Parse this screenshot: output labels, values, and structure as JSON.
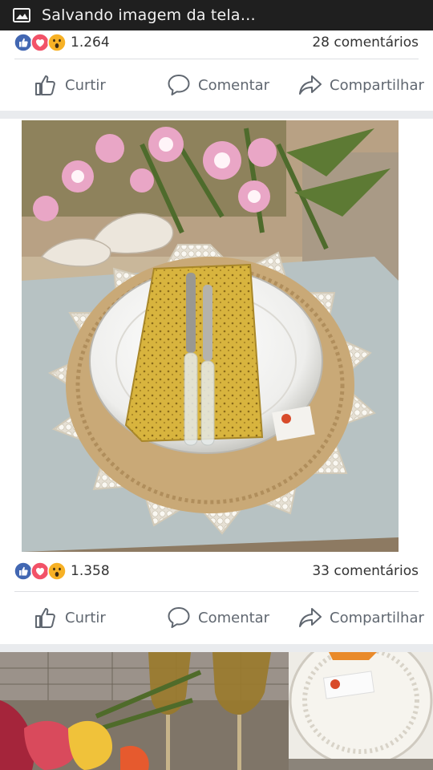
{
  "status_bar": {
    "text": "Salvando imagem da tela…",
    "icon": "image-icon"
  },
  "actions": {
    "like": "Curtir",
    "comment": "Comentar",
    "share": "Compartilhar"
  },
  "posts": [
    {
      "reactions_count": "1.264",
      "comments_count": "28 comentários"
    },
    {
      "reactions_count": "1.358",
      "comments_count": "33 comentários",
      "image_alt": "Sousplat de pérolas com prato branco, guardanapo amarelo e talheres sobre mesa com flores"
    },
    {
      "image_alt": "Taças âmbar, flores copo-de-leite e sousplat de pérolas"
    }
  ],
  "colors": {
    "like_blue": "#4267b2",
    "love_red": "#f25268",
    "wow_yellow": "#f7b125",
    "text_gray": "#606770"
  }
}
